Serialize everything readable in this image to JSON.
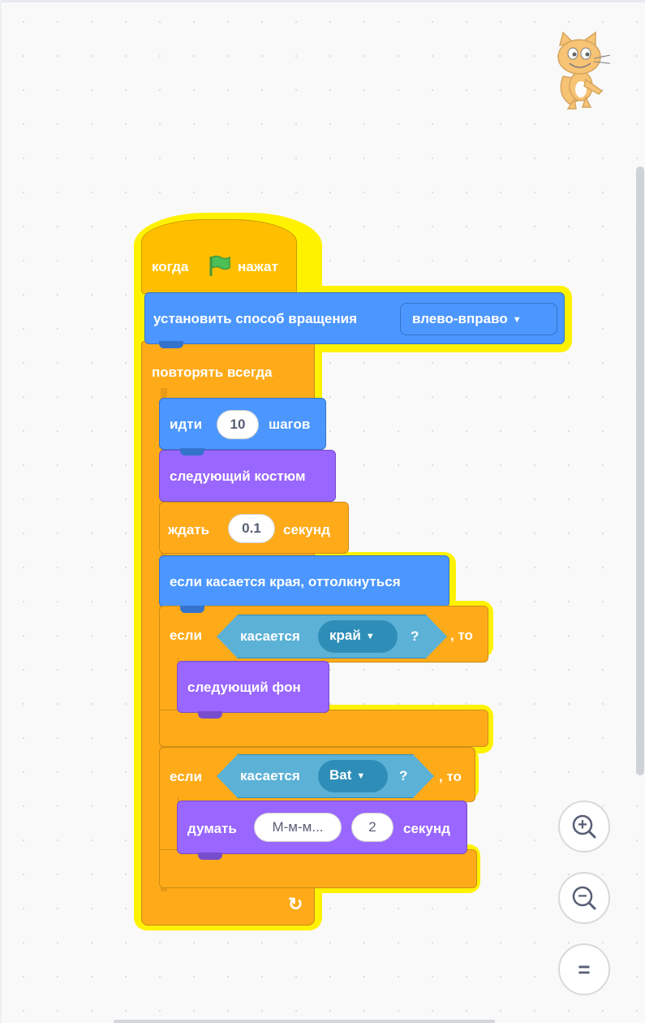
{
  "script": {
    "hat_label_when": "когда",
    "hat_label_clicked": "нажат",
    "rotation_label": "установить способ вращения",
    "rotation_value": "влево-вправо",
    "forever_label": "повторять всегда",
    "move_label": "идти",
    "move_steps": "10",
    "move_unit": "шагов",
    "next_costume_label": "следующий костюм",
    "wait_label": "ждать",
    "wait_value": "0.1",
    "wait_unit": "секунд",
    "bounce_label": "если касается края, оттолкнуться",
    "if1_label": "если",
    "if1_sensor_label": "касается",
    "if1_sensor_value": "край",
    "if1_question": "?",
    "if1_then": ", то",
    "next_backdrop_label": "следующий фон",
    "if2_label": "если",
    "if2_sensor_label": "касается",
    "if2_sensor_value": "Bat",
    "if2_question": "?",
    "if2_then": ", то",
    "think_label": "думать",
    "think_text": "М-м-м...",
    "think_secs": "2",
    "think_unit": "секунд",
    "loop_arrow": "↻"
  },
  "zoom": {
    "zoom_in_symbol": "+",
    "zoom_out_symbol": "−",
    "reset_symbol": "="
  },
  "icons": [
    "green-flag-icon",
    "caret-down-icon",
    "loop-arrow-icon",
    "sprite-cat-icon",
    "zoom-in-icon",
    "zoom-out-icon",
    "zoom-reset-icon"
  ],
  "colors": {
    "events": "#ffbf00",
    "control": "#ffab19",
    "motion": "#4c97ff",
    "looks": "#9966ff",
    "sensing": "#5cb1d6",
    "glow": "#fff200"
  }
}
